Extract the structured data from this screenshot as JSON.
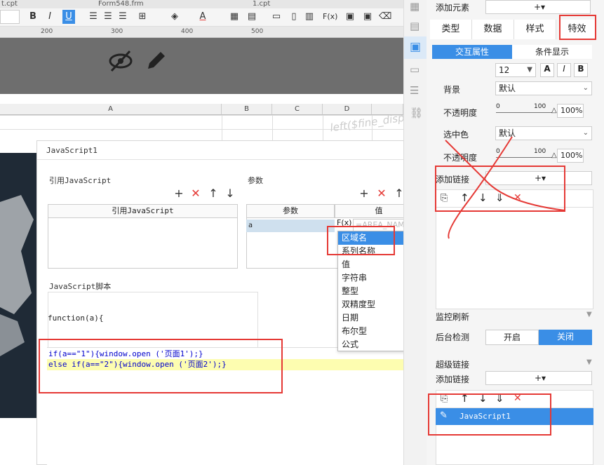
{
  "toolbar": {
    "tabs": [
      "t.cpt",
      "Form548.frm",
      "1.cpt"
    ],
    "bold": "B",
    "italic": "I",
    "underline": "U",
    "ruler": [
      "200",
      "300",
      "400",
      "500"
    ]
  },
  "sheet": {
    "columns": [
      "A",
      "B",
      "C",
      "D"
    ],
    "watermark": "left($fine_disp"
  },
  "dialog": {
    "title": "JavaScript1",
    "ref_section_title": "引用JavaScript",
    "ref_table_header": "引用JavaScript",
    "params_section_title": "参数",
    "params_headers": [
      "参数",
      "值"
    ],
    "param_row": {
      "name": "a",
      "fx": "F(x)",
      "value_placeholder": "=AREA_NAME"
    },
    "script_section_title": "JavaScript脚本",
    "function_sig": "function(a){",
    "code_line1": "if(a==\"1\"){window.open ('页面1');}",
    "code_line2": "else if(a==\"2\"){window.open ('页面2');}"
  },
  "dropdown": {
    "items": [
      "区域名",
      "系列名称",
      "值",
      "字符串",
      "整型",
      "双精度型",
      "日期",
      "布尔型",
      "公式"
    ],
    "selected": "区域名"
  },
  "right_panel": {
    "add_element": "添加元素",
    "tabs": [
      "类型",
      "数据",
      "样式",
      "特效"
    ],
    "active_tab": "特效",
    "subtabs": [
      "交互属性",
      "条件显示"
    ],
    "font_size": "12",
    "bg_label": "背景",
    "bg_value": "默认",
    "opacity_label": "不透明度",
    "opacity_value": "100%",
    "slider_min": "0",
    "slider_max": "100",
    "select_color_label": "选中色",
    "select_color_value": "默认",
    "opacity2_label": "不透明度",
    "opacity2_value": "100%",
    "add_link_label": "添加链接",
    "monitor_refresh": "监控刷新",
    "bg_check_label": "后台检测",
    "on_label": "开启",
    "off_label": "关闭",
    "hyperlink_label": "超级链接",
    "add_link2_label": "添加链接",
    "link_item": "JavaScript1"
  },
  "colors": {
    "accent": "#3a8ee6",
    "annotation": "#e53935",
    "highlight_line": "#fdfdb0"
  }
}
